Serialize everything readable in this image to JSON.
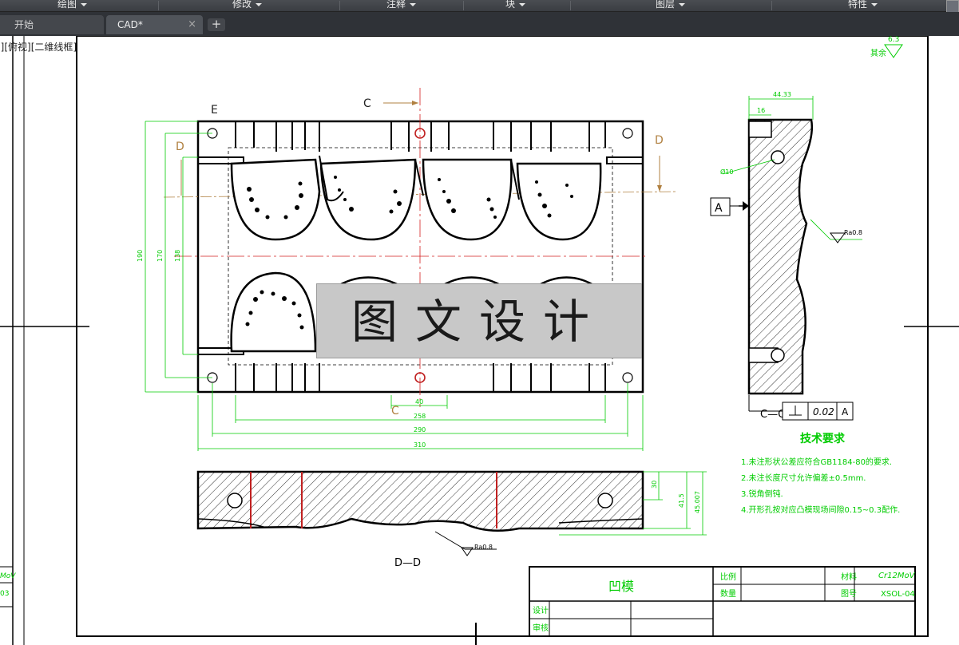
{
  "ribbon": {
    "panels": [
      {
        "label": "绘图"
      },
      {
        "label": "修改"
      },
      {
        "label": "注释"
      },
      {
        "label": "块"
      },
      {
        "label": "图层"
      },
      {
        "label": "特性"
      }
    ]
  },
  "tabs": {
    "start_label": "开始",
    "doc_label": "CAD*",
    "close_symbol": "×",
    "new_tab_symbol": "+"
  },
  "viewport": {
    "label": "]][俯视][二维线框]"
  },
  "watermark": {
    "text": "图文设计"
  },
  "drawing": {
    "section_labels": {
      "e": "E",
      "c_top": "C",
      "c_bottom": "C",
      "d_left": "D",
      "d_right": "D",
      "dd": "D—D",
      "cc": "C—C",
      "datum": "A"
    },
    "surface": {
      "finish_other": "其余",
      "finish_value": "6.3",
      "ra": "Ra0.8"
    },
    "dims_top": {
      "d40": "40",
      "d258": "258",
      "d290": "290",
      "d310": "310",
      "v190": "190",
      "v170": "170",
      "v138": "138"
    },
    "dims_side": {
      "w44": "44.33",
      "w16": "16",
      "hole": "Ø10"
    },
    "dims_bottom": {
      "h30": "30",
      "h415": "41.5",
      "h45": "45.007"
    },
    "tolerance": {
      "value": "0.02",
      "datum": "A"
    },
    "tech": {
      "title": "技术要求",
      "items": [
        "1.未注形状公差应符合GB1184-80的要求.",
        "2.未注长度尺寸允许偏差±0.5mm.",
        "3.锐角倒钝.",
        "4.开形孔按对应凸模现场间隙0.15~0.3配作."
      ]
    },
    "title_block": {
      "part_name": "凹模",
      "scale_label": "比例",
      "qty_label": "数量",
      "material_label": "材料",
      "material_value": "Cr12MoV",
      "drawing_no_label": "图号",
      "drawing_no_value": "XSOL-04",
      "design_label": "设计",
      "review_label": "审核"
    },
    "left_frag": {
      "a": "MoV",
      "b": "03"
    }
  },
  "colors": {
    "ribbon_bg": "#3a3d42",
    "dimension_green": "#00cc00",
    "centerline_red": "#d42020",
    "outline": "#000000",
    "watermark_bg": "#c8c8c8"
  }
}
